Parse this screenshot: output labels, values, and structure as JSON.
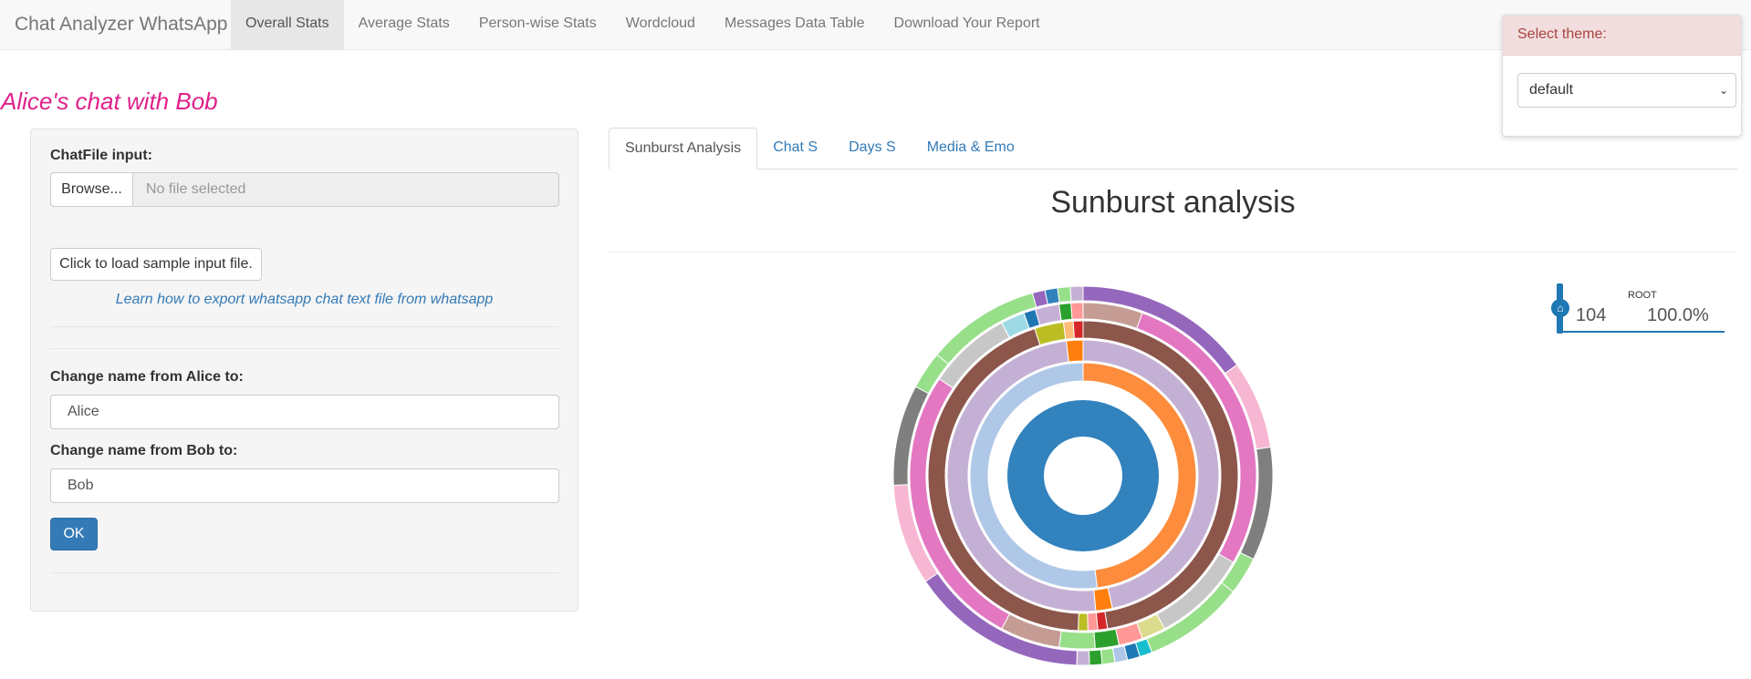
{
  "app": {
    "brand": "Chat Analyzer WhatsApp",
    "nav": [
      {
        "label": "Overall Stats",
        "active": true
      },
      {
        "label": "Average Stats"
      },
      {
        "label": "Person-wise Stats"
      },
      {
        "label": "Wordcloud"
      },
      {
        "label": "Messages Data Table"
      },
      {
        "label": "Download Your Report"
      }
    ]
  },
  "page": {
    "title": "Alice's chat with Bob"
  },
  "sidebar": {
    "file_label": "ChatFile input:",
    "browse_label": "Browse...",
    "file_placeholder": "No file selected",
    "sample_button": "Click to load sample input file.",
    "help_link": "Learn how to export whatsapp chat text file from whatsapp",
    "name1_label": "Change name from Alice to:",
    "name1_value": "Alice",
    "name2_label": "Change name from Bob to:",
    "name2_value": "Bob",
    "ok_label": "OK"
  },
  "tabs": [
    {
      "label": "Sunburst Analysis",
      "active": true
    },
    {
      "label": "Chat S"
    },
    {
      "label": "Days S"
    },
    {
      "label": "Media & Emo"
    }
  ],
  "content": {
    "title": "Sunburst analysis"
  },
  "sequence": {
    "root_label": "ROOT",
    "count": "104",
    "percent": "100.0%",
    "color": "#1f77b4"
  },
  "theme": {
    "header": "Select theme:",
    "selected": "default"
  },
  "chart_data": {
    "type": "sunburst",
    "total": 104,
    "rings": [
      {
        "level": 1,
        "segments": [
          {
            "value": 104,
            "color": "#3182bd"
          }
        ]
      },
      {
        "level": 2,
        "segments": [
          {
            "value": 48,
            "color": "#fd8d3c"
          },
          {
            "value": 52,
            "color": "#b0c8e8"
          }
        ]
      },
      {
        "level": 3,
        "segments": [
          {
            "value": 47,
            "color": "#c5b0d5"
          },
          {
            "value": 2,
            "color": "#ff7f0e"
          },
          {
            "value": 50,
            "color": "#c5b0d5"
          },
          {
            "value": 2,
            "color": "#ff7f0e"
          }
        ]
      },
      {
        "level": 4,
        "segments": [
          {
            "value": 47,
            "color": "#8c564b"
          },
          {
            "value": 1,
            "color": "#d62728"
          },
          {
            "value": 1,
            "color": "#ff9896"
          },
          {
            "value": 1,
            "color": "#bcbd22"
          },
          {
            "value": 44,
            "color": "#8c564b"
          },
          {
            "value": 3,
            "color": "#bcbd22"
          },
          {
            "value": 1,
            "color": "#ffbb78"
          },
          {
            "value": 1,
            "color": "#d62728"
          }
        ]
      },
      {
        "level": 5,
        "segments": [
          {
            "value": 5,
            "color": "#c49c94"
          },
          {
            "value": 25,
            "color": "#e377c2"
          },
          {
            "value": 8,
            "color": "#c7c7c7"
          },
          {
            "value": 2,
            "color": "#dbdb8d"
          },
          {
            "value": 2,
            "color": "#ff9896"
          },
          {
            "value": 2,
            "color": "#2ca02c"
          },
          {
            "value": 3,
            "color": "#98df8a"
          },
          {
            "value": 5,
            "color": "#c49c94"
          },
          {
            "value": 24,
            "color": "#e377c2"
          },
          {
            "value": 7,
            "color": "#c7c7c7"
          },
          {
            "value": 2,
            "color": "#9edae5"
          },
          {
            "value": 1,
            "color": "#1f77b4"
          },
          {
            "value": 2,
            "color": "#c5b0d5"
          },
          {
            "value": 1,
            "color": "#2ca02c"
          },
          {
            "value": 1,
            "color": "#ff9896"
          }
        ]
      },
      {
        "level": 6,
        "segments": [
          {
            "value": 14,
            "color": "#9467bd"
          },
          {
            "value": 7,
            "color": "#f7b6d2"
          },
          {
            "value": 9,
            "color": "#7f7f7f"
          },
          {
            "value": 3,
            "color": "#98df8a"
          },
          {
            "value": 8,
            "color": "#98df8a"
          },
          {
            "value": 1,
            "color": "#17becf"
          },
          {
            "value": 1,
            "color": "#1f77b4"
          },
          {
            "value": 1,
            "color": "#aec7e8"
          },
          {
            "value": 1,
            "color": "#98df8a"
          },
          {
            "value": 1,
            "color": "#2ca02c"
          },
          {
            "value": 1,
            "color": "#c5b0d5"
          },
          {
            "value": 14,
            "color": "#9467bd"
          },
          {
            "value": 8,
            "color": "#f7b6d2"
          },
          {
            "value": 8,
            "color": "#7f7f7f"
          },
          {
            "value": 3,
            "color": "#98df8a"
          },
          {
            "value": 9,
            "color": "#98df8a"
          },
          {
            "value": 1,
            "color": "#9467bd"
          },
          {
            "value": 1,
            "color": "#3182bd"
          },
          {
            "value": 1,
            "color": "#98df8a"
          },
          {
            "value": 1,
            "color": "#c5b0d5"
          }
        ]
      }
    ]
  }
}
